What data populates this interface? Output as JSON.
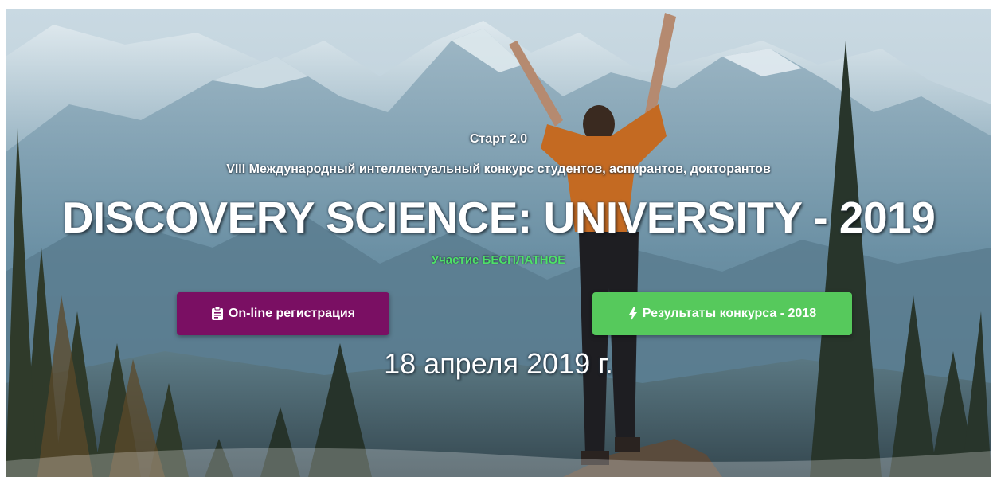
{
  "hero": {
    "subtitle": "Старт 2.0",
    "tagline": "VIII Международный интеллектуальный конкурс студентов, аспирантов, докторантов",
    "title": "DISCOVERY SCIENCE: UNIVERSITY - 2019",
    "participation": "Участие БЕСПЛАТНОЕ",
    "date": "18 апреля 2019 г."
  },
  "buttons": {
    "registration": {
      "label": "On-line регистрация",
      "icon": "clipboard-icon",
      "color": "#7a0f63"
    },
    "results": {
      "label": "Результаты конкурса - 2018",
      "icon": "lightning-icon",
      "color": "#56c95c"
    }
  },
  "colors": {
    "participation_text": "#4ee06a",
    "sky": "#b9cbd6",
    "mountain": "#6f94a8"
  }
}
